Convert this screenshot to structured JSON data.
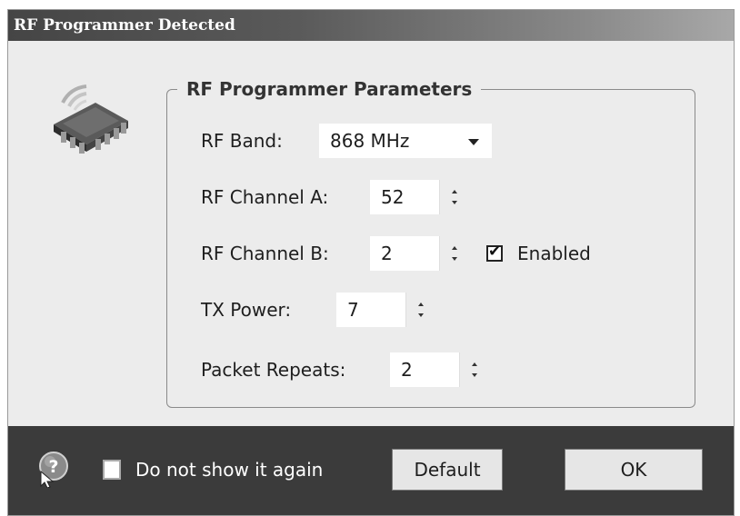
{
  "window": {
    "title": "RF Programmer Detected"
  },
  "icons": {
    "app": "wireless-chip-icon",
    "help": "help-question-icon"
  },
  "group": {
    "title": "RF Programmer Parameters"
  },
  "fields": {
    "rf_band": {
      "label": "RF Band:",
      "value": "868 MHz"
    },
    "channel_a": {
      "label": "RF Channel A:",
      "value": "52"
    },
    "channel_b": {
      "label": "RF Channel B:",
      "value": "2",
      "enabled_label": "Enabled",
      "enabled": true
    },
    "tx_power": {
      "label": "TX Power:",
      "value": "7"
    },
    "packet_repeats": {
      "label": "Packet Repeats:",
      "value": "2"
    }
  },
  "footer": {
    "dont_show_label": "Do not show it again",
    "dont_show_checked": false,
    "default_button": "Default",
    "ok_button": "OK"
  },
  "colors": {
    "title_bar": "#454545",
    "footer": "#3b3b3b",
    "panel": "#ececec"
  }
}
